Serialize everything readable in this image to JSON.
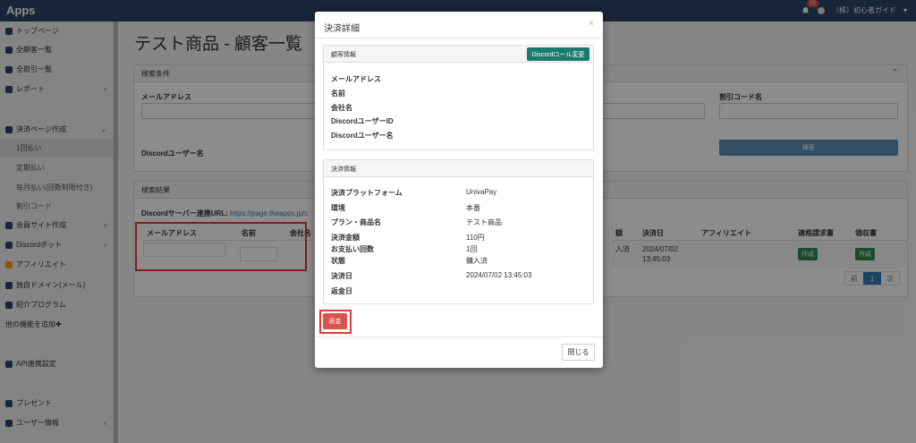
{
  "topbar": {
    "brand": "Apps",
    "notif_count": "10",
    "user": "（株）初心者ガイド",
    "caret": "▾"
  },
  "sidebar": {
    "items": [
      {
        "label": "トップページ"
      },
      {
        "label": "全顧客一覧"
      },
      {
        "label": "全取引一覧"
      },
      {
        "label": "レポート",
        "chev": "‹"
      },
      {
        "label": "決済ページ作成",
        "chev": "⌄"
      },
      {
        "label": "1回払い"
      },
      {
        "label": "定期払い"
      },
      {
        "label": "毎月払い(回数制限付き)"
      },
      {
        "label": "割引コード"
      },
      {
        "label": "会員サイト作成",
        "chev": "‹"
      },
      {
        "label": "Discordボット",
        "chev": "‹"
      },
      {
        "label": "アフィリエイト"
      },
      {
        "label": "独自ドメイン(メール)"
      },
      {
        "label": "紹介プログラム"
      },
      {
        "label": "他の機能を追加✚"
      },
      {
        "label": "API連携設定"
      },
      {
        "label": "プレゼント"
      },
      {
        "label": "ユーザー情報",
        "chev": "‹"
      }
    ]
  },
  "page": {
    "title": "テスト商品 - 顧客一覧"
  },
  "search": {
    "header": "検索条件",
    "email_label": "メールアドレス",
    "discord_label": "Discordユーザー名",
    "discount_label": "割引コード名",
    "search_button": "検索",
    "collapse": "⌃"
  },
  "results": {
    "header": "検索結果",
    "discord_url_label": "Discordサーバー連携URL:",
    "discord_url": "https://page.theapps.jp/c",
    "columns": [
      "メールアドレス",
      "名前",
      "会社名"
    ],
    "right_columns": [
      "額",
      "決済日",
      "アフィリエイト",
      "適格請求書",
      "領収書"
    ],
    "row": {
      "payment_status": "入済",
      "date": "2024/07/02 13:45:03",
      "invoice_btn": "作成",
      "receipt_btn": "作成"
    },
    "pager": {
      "prev": "前",
      "page": "1",
      "next": "次"
    }
  },
  "modal": {
    "title": "決済詳細",
    "close_x": "×",
    "customer": {
      "header": "顧客情報",
      "role_button": "Discordロール変更",
      "fields": [
        "メールアドレス",
        "名前",
        "会社名",
        "DiscordユーザーID",
        "Discordユーザー名"
      ]
    },
    "payment": {
      "header": "決済情報",
      "rows": [
        {
          "label": "決済プラットフォーム",
          "value": "UnivaPay"
        },
        {
          "label": "環境",
          "value": "本番"
        },
        {
          "label": "プラン・商品名",
          "value": "テスト商品"
        },
        {
          "label": "決済金額",
          "value": "110円"
        },
        {
          "label": "お支払い回数",
          "value": "1回"
        },
        {
          "label": "状態",
          "value": "購入済"
        },
        {
          "label": "決済日",
          "value": "2024/07/02 13:45:03"
        },
        {
          "label": "返金日",
          "value": ""
        }
      ]
    },
    "refund_button": "返金",
    "close_button": "閉じる"
  }
}
